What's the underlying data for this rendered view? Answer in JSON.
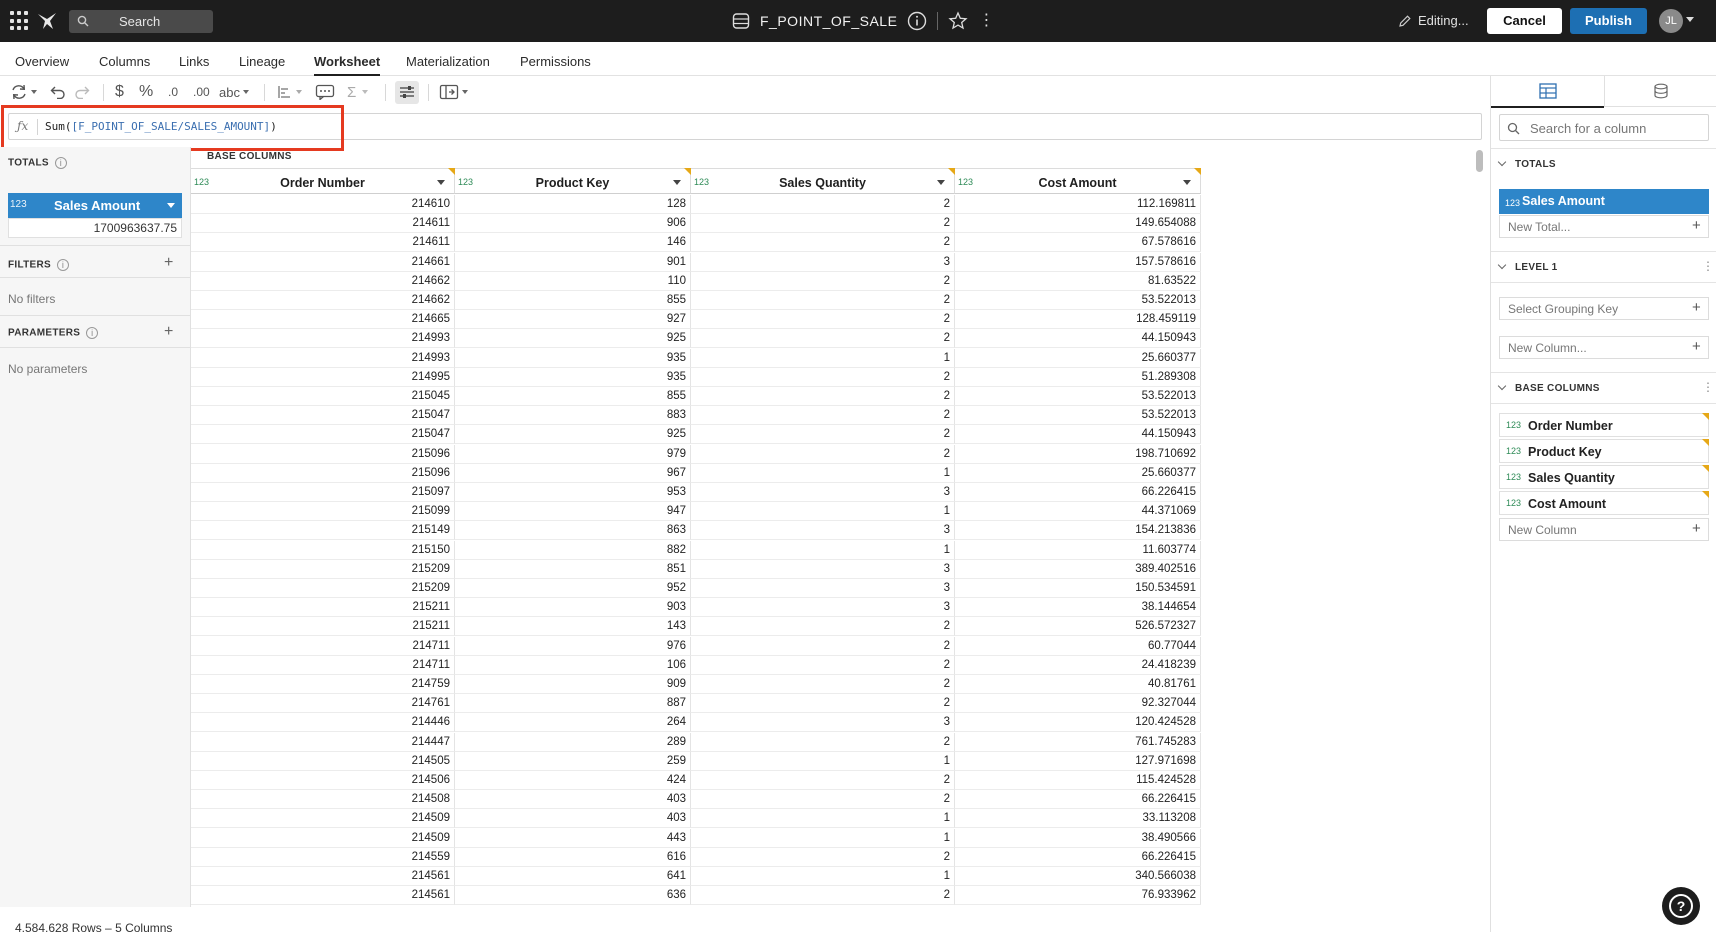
{
  "topbar": {
    "search_label": "Search",
    "doc_title": "F_POINT_OF_SALE",
    "editing_label": "Editing...",
    "cancel_label": "Cancel",
    "publish_label": "Publish",
    "avatar_initials": "JL"
  },
  "tabs": [
    {
      "label": "Overview"
    },
    {
      "label": "Columns"
    },
    {
      "label": "Links"
    },
    {
      "label": "Lineage"
    },
    {
      "label": "Worksheet",
      "active": true
    },
    {
      "label": "Materialization"
    },
    {
      "label": "Permissions"
    }
  ],
  "toolbar": {
    "text_format_label": "abc"
  },
  "formula": {
    "fx": "ƒx",
    "func": "Sum(",
    "ref": "[F_POINT_OF_SALE/SALES_AMOUNT]",
    "close": ")"
  },
  "left_panel": {
    "totals_title": "TOTALS",
    "total_type": "123",
    "total_name": "Sales Amount",
    "total_value": "1700963637.75",
    "filters_title": "FILTERS",
    "filters_empty": "No filters",
    "parameters_title": "PARAMETERS",
    "parameters_empty": "No parameters"
  },
  "grid": {
    "section_label": "BASE COLUMNS",
    "type_label": "123",
    "columns": [
      "Order Number",
      "Product Key",
      "Sales Quantity",
      "Cost Amount"
    ],
    "rows": [
      [
        "214610",
        "128",
        "2",
        "112.169811"
      ],
      [
        "214611",
        "906",
        "2",
        "149.654088"
      ],
      [
        "214611",
        "146",
        "2",
        "67.578616"
      ],
      [
        "214661",
        "901",
        "3",
        "157.578616"
      ],
      [
        "214662",
        "110",
        "2",
        "81.63522"
      ],
      [
        "214662",
        "855",
        "2",
        "53.522013"
      ],
      [
        "214665",
        "927",
        "2",
        "128.459119"
      ],
      [
        "214993",
        "925",
        "2",
        "44.150943"
      ],
      [
        "214993",
        "935",
        "1",
        "25.660377"
      ],
      [
        "214995",
        "935",
        "2",
        "51.289308"
      ],
      [
        "215045",
        "855",
        "2",
        "53.522013"
      ],
      [
        "215047",
        "883",
        "2",
        "53.522013"
      ],
      [
        "215047",
        "925",
        "2",
        "44.150943"
      ],
      [
        "215096",
        "979",
        "2",
        "198.710692"
      ],
      [
        "215096",
        "967",
        "1",
        "25.660377"
      ],
      [
        "215097",
        "953",
        "3",
        "66.226415"
      ],
      [
        "215099",
        "947",
        "1",
        "44.371069"
      ],
      [
        "215149",
        "863",
        "3",
        "154.213836"
      ],
      [
        "215150",
        "882",
        "1",
        "11.603774"
      ],
      [
        "215209",
        "851",
        "3",
        "389.402516"
      ],
      [
        "215209",
        "952",
        "3",
        "150.534591"
      ],
      [
        "215211",
        "903",
        "3",
        "38.144654"
      ],
      [
        "215211",
        "143",
        "2",
        "526.572327"
      ],
      [
        "214711",
        "976",
        "2",
        "60.77044"
      ],
      [
        "214711",
        "106",
        "2",
        "24.418239"
      ],
      [
        "214759",
        "909",
        "2",
        "40.81761"
      ],
      [
        "214761",
        "887",
        "2",
        "92.327044"
      ],
      [
        "214446",
        "264",
        "3",
        "120.424528"
      ],
      [
        "214447",
        "289",
        "2",
        "761.745283"
      ],
      [
        "214505",
        "259",
        "1",
        "127.971698"
      ],
      [
        "214506",
        "424",
        "2",
        "115.424528"
      ],
      [
        "214508",
        "403",
        "2",
        "66.226415"
      ],
      [
        "214509",
        "403",
        "1",
        "33.113208"
      ],
      [
        "214509",
        "443",
        "1",
        "38.490566"
      ],
      [
        "214559",
        "616",
        "2",
        "66.226415"
      ],
      [
        "214561",
        "641",
        "1",
        "340.566038"
      ],
      [
        "214561",
        "636",
        "2",
        "76.933962"
      ]
    ]
  },
  "status": "4,584,628 Rows – 5 Columns",
  "right_panel": {
    "search_placeholder": "Search for a column",
    "totals_title": "TOTALS",
    "total_type": "123",
    "total_name": "Sales Amount",
    "new_total": "New Total...",
    "level_title": "LEVEL 1",
    "grouping_key": "Select Grouping Key",
    "new_column_dots": "New Column...",
    "base_title": "BASE COLUMNS",
    "base_type": "123",
    "base_columns": [
      "Order Number",
      "Product Key",
      "Sales Quantity",
      "Cost Amount"
    ],
    "new_column": "New Column"
  }
}
